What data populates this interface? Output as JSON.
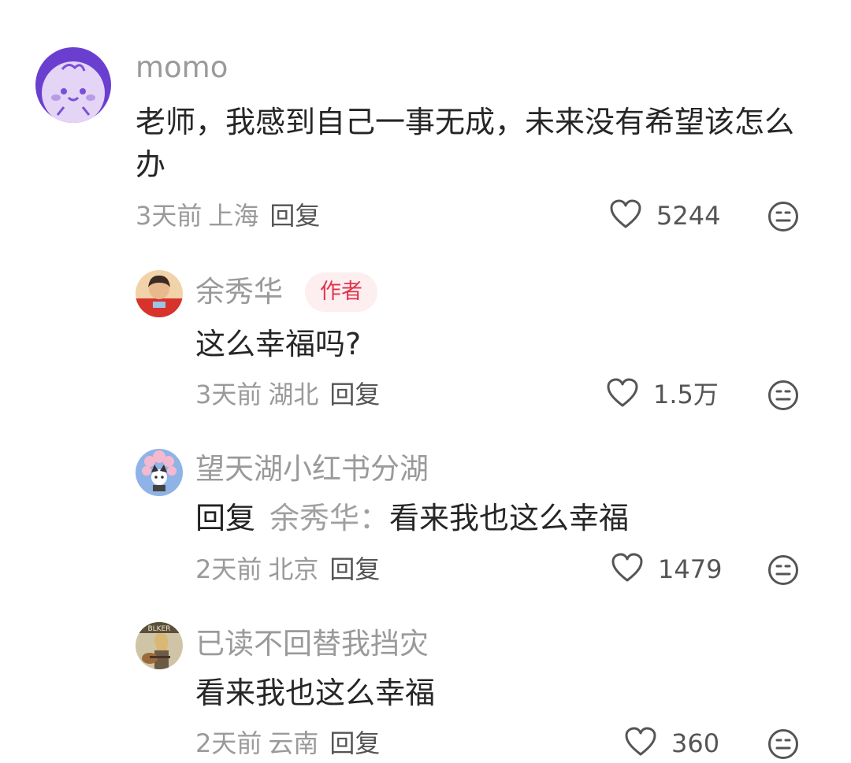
{
  "comments": [
    {
      "username": "momo",
      "text": "老师，我感到自己一事无成，未来没有希望该怎么办",
      "time": "3天前",
      "location": "上海",
      "reply_label": "回复",
      "likes": "5244"
    },
    {
      "username": "余秀华",
      "badge": "作者",
      "text": "这么幸福吗?",
      "time": "3天前",
      "location": "湖北",
      "reply_label": "回复",
      "likes": "1.5万"
    },
    {
      "username": "望天湖小红书分湖",
      "reply_prefix": "回复",
      "reply_target": "余秀华：",
      "text": "看来我也这么幸福",
      "time": "2天前",
      "location": "北京",
      "reply_label": "回复",
      "likes": "1479"
    },
    {
      "username": "已读不回替我挡灾",
      "text": "看来我也这么幸福",
      "time": "2天前",
      "location": "云南",
      "reply_label": "回复",
      "likes": "360"
    }
  ],
  "icons": {
    "like": "heart-outline-icon",
    "emoji": "emoji-face-icon"
  },
  "colors": {
    "username": "#9a9a9a",
    "text": "#262626",
    "badge_bg": "#fdeef0",
    "badge_text": "#e0344c"
  }
}
